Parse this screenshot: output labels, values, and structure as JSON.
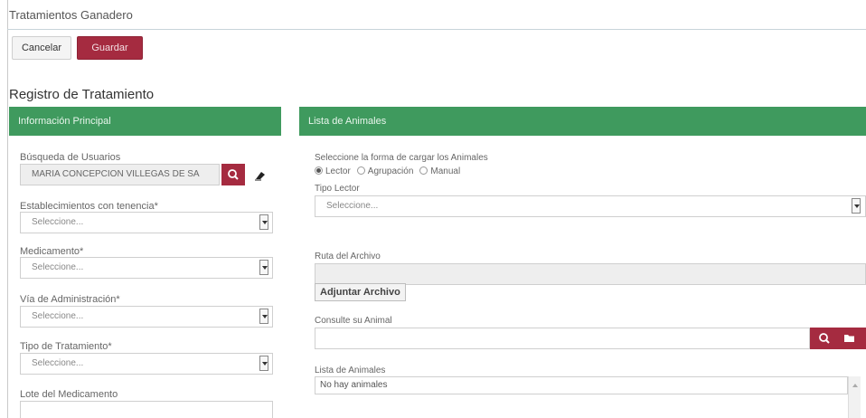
{
  "app": {
    "title": "Tratamientos Ganadero"
  },
  "toolbar": {
    "cancel_label": "Cancelar",
    "save_label": "Guardar"
  },
  "page": {
    "title": "Registro de Tratamiento"
  },
  "left_panel": {
    "header": "Información Principal",
    "user_search": {
      "label": "Búsqueda de Usuarios",
      "value": "MARIA CONCEPCION VILLEGAS DE SA"
    },
    "establishments": {
      "label": "Establecimientos con tenencia*",
      "value": "Seleccione..."
    },
    "medication": {
      "label": "Medicamento*",
      "value": "Seleccione..."
    },
    "route": {
      "label": "Vía de Administración*",
      "value": "Seleccione..."
    },
    "treatment_type": {
      "label": "Tipo de Tratamiento*",
      "value": "Seleccione..."
    },
    "batch": {
      "label": "Lote del Medicamento",
      "value": ""
    }
  },
  "right_panel": {
    "header": "Lista de Animales",
    "load_mode": {
      "label": "Seleccione la forma de cargar los Animales",
      "options": [
        "Lector",
        "Agrupación",
        "Manual"
      ],
      "selected": "Lector"
    },
    "reader_type": {
      "label": "Tipo Lector",
      "value": "Seleccione..."
    },
    "file_path": {
      "label": "Ruta del Archivo",
      "value": ""
    },
    "attach_label": "Adjuntar Archivo",
    "animal_query": {
      "label": "Consulte su Animal",
      "value": ""
    },
    "animal_list": {
      "label": "Lista de Animales",
      "value": "No hay animales"
    }
  },
  "colors": {
    "accent": "#a52b40",
    "panel_header": "#3f9a5e"
  },
  "icons": [
    "search-icon",
    "eraser-icon",
    "folder-icon",
    "select-arrow-icon"
  ]
}
